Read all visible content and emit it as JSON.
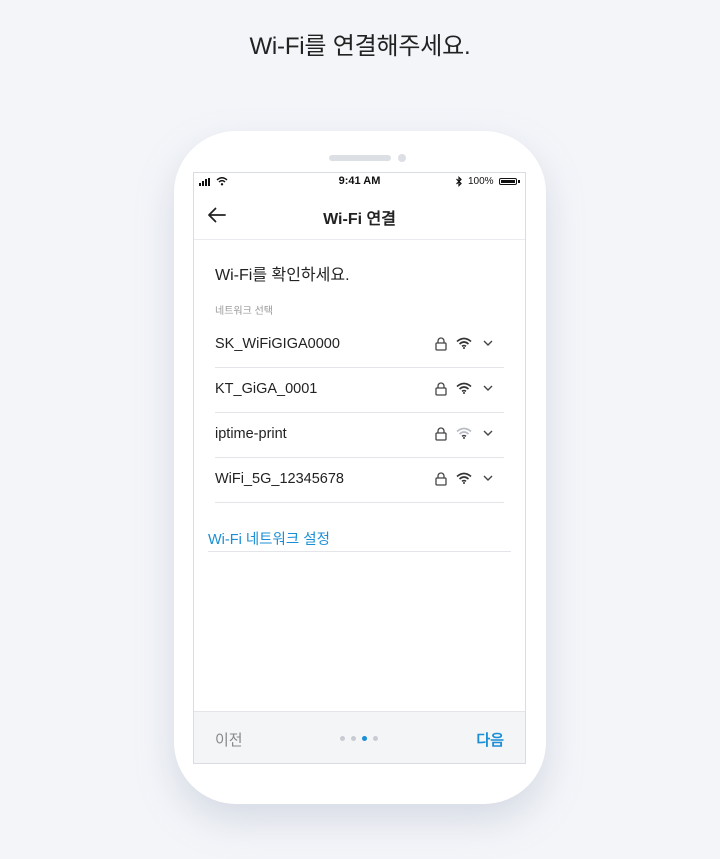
{
  "page_heading": "Wi-Fi를 연결해주세요.",
  "status_bar": {
    "time": "9:41 AM",
    "battery": "100%"
  },
  "header": {
    "title": "Wi-Fi 연결"
  },
  "content": {
    "prompt": "Wi-Fi를 확인하세요.",
    "section_label": "네트워크 선택",
    "networks": [
      {
        "name": "SK_WiFiGIGA0000",
        "signal": "strong",
        "locked": true
      },
      {
        "name": "KT_GiGA_0001",
        "signal": "strong",
        "locked": true
      },
      {
        "name": "iptime-print",
        "signal": "weak",
        "locked": true
      },
      {
        "name": "WiFi_5G_12345678",
        "signal": "strong",
        "locked": true
      }
    ],
    "settings_link": "Wi-Fi 네트워크 설정"
  },
  "footer": {
    "prev_label": "이전",
    "next_label": "다음",
    "page_indicator": {
      "total": 4,
      "current": 3
    }
  },
  "colors": {
    "accent": "#1b8fd6",
    "background": "#f3f5f9",
    "weak_signal": "#b8bcc2"
  },
  "icons": [
    "back-arrow-icon",
    "lock-icon",
    "wifi-icon",
    "chevron-down-icon",
    "bluetooth-icon",
    "battery-icon",
    "signal-icon"
  ]
}
